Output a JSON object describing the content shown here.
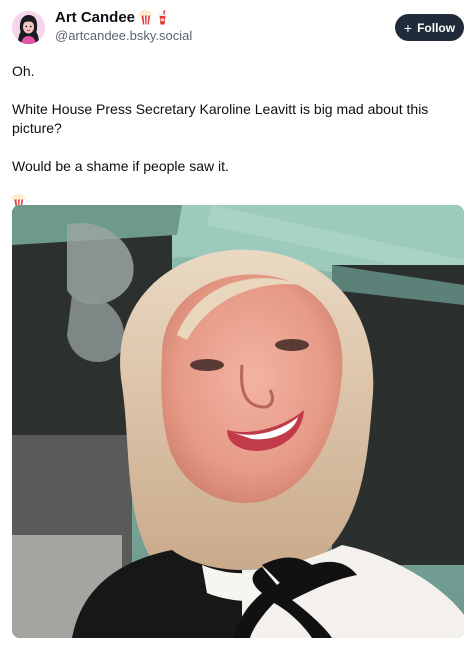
{
  "author": {
    "display_name": "Art Candee",
    "handle": "@artcandee.bsky.social",
    "name_emojis": [
      "popcorn-icon",
      "drink-icon"
    ]
  },
  "follow_button": {
    "label": "Follow",
    "icon": "plus-icon"
  },
  "post": {
    "paragraphs": [
      "Oh.",
      "White House Press Secretary Karoline Leavitt is big mad about this picture?",
      "Would be a shame if people saw it."
    ],
    "trailing_emoji": "popcorn-icon"
  },
  "media": {
    "type": "photo"
  },
  "colors": {
    "follow_button_bg": "#1f2a3a",
    "handle_text": "#5b6673",
    "text": "#0b0f14"
  }
}
